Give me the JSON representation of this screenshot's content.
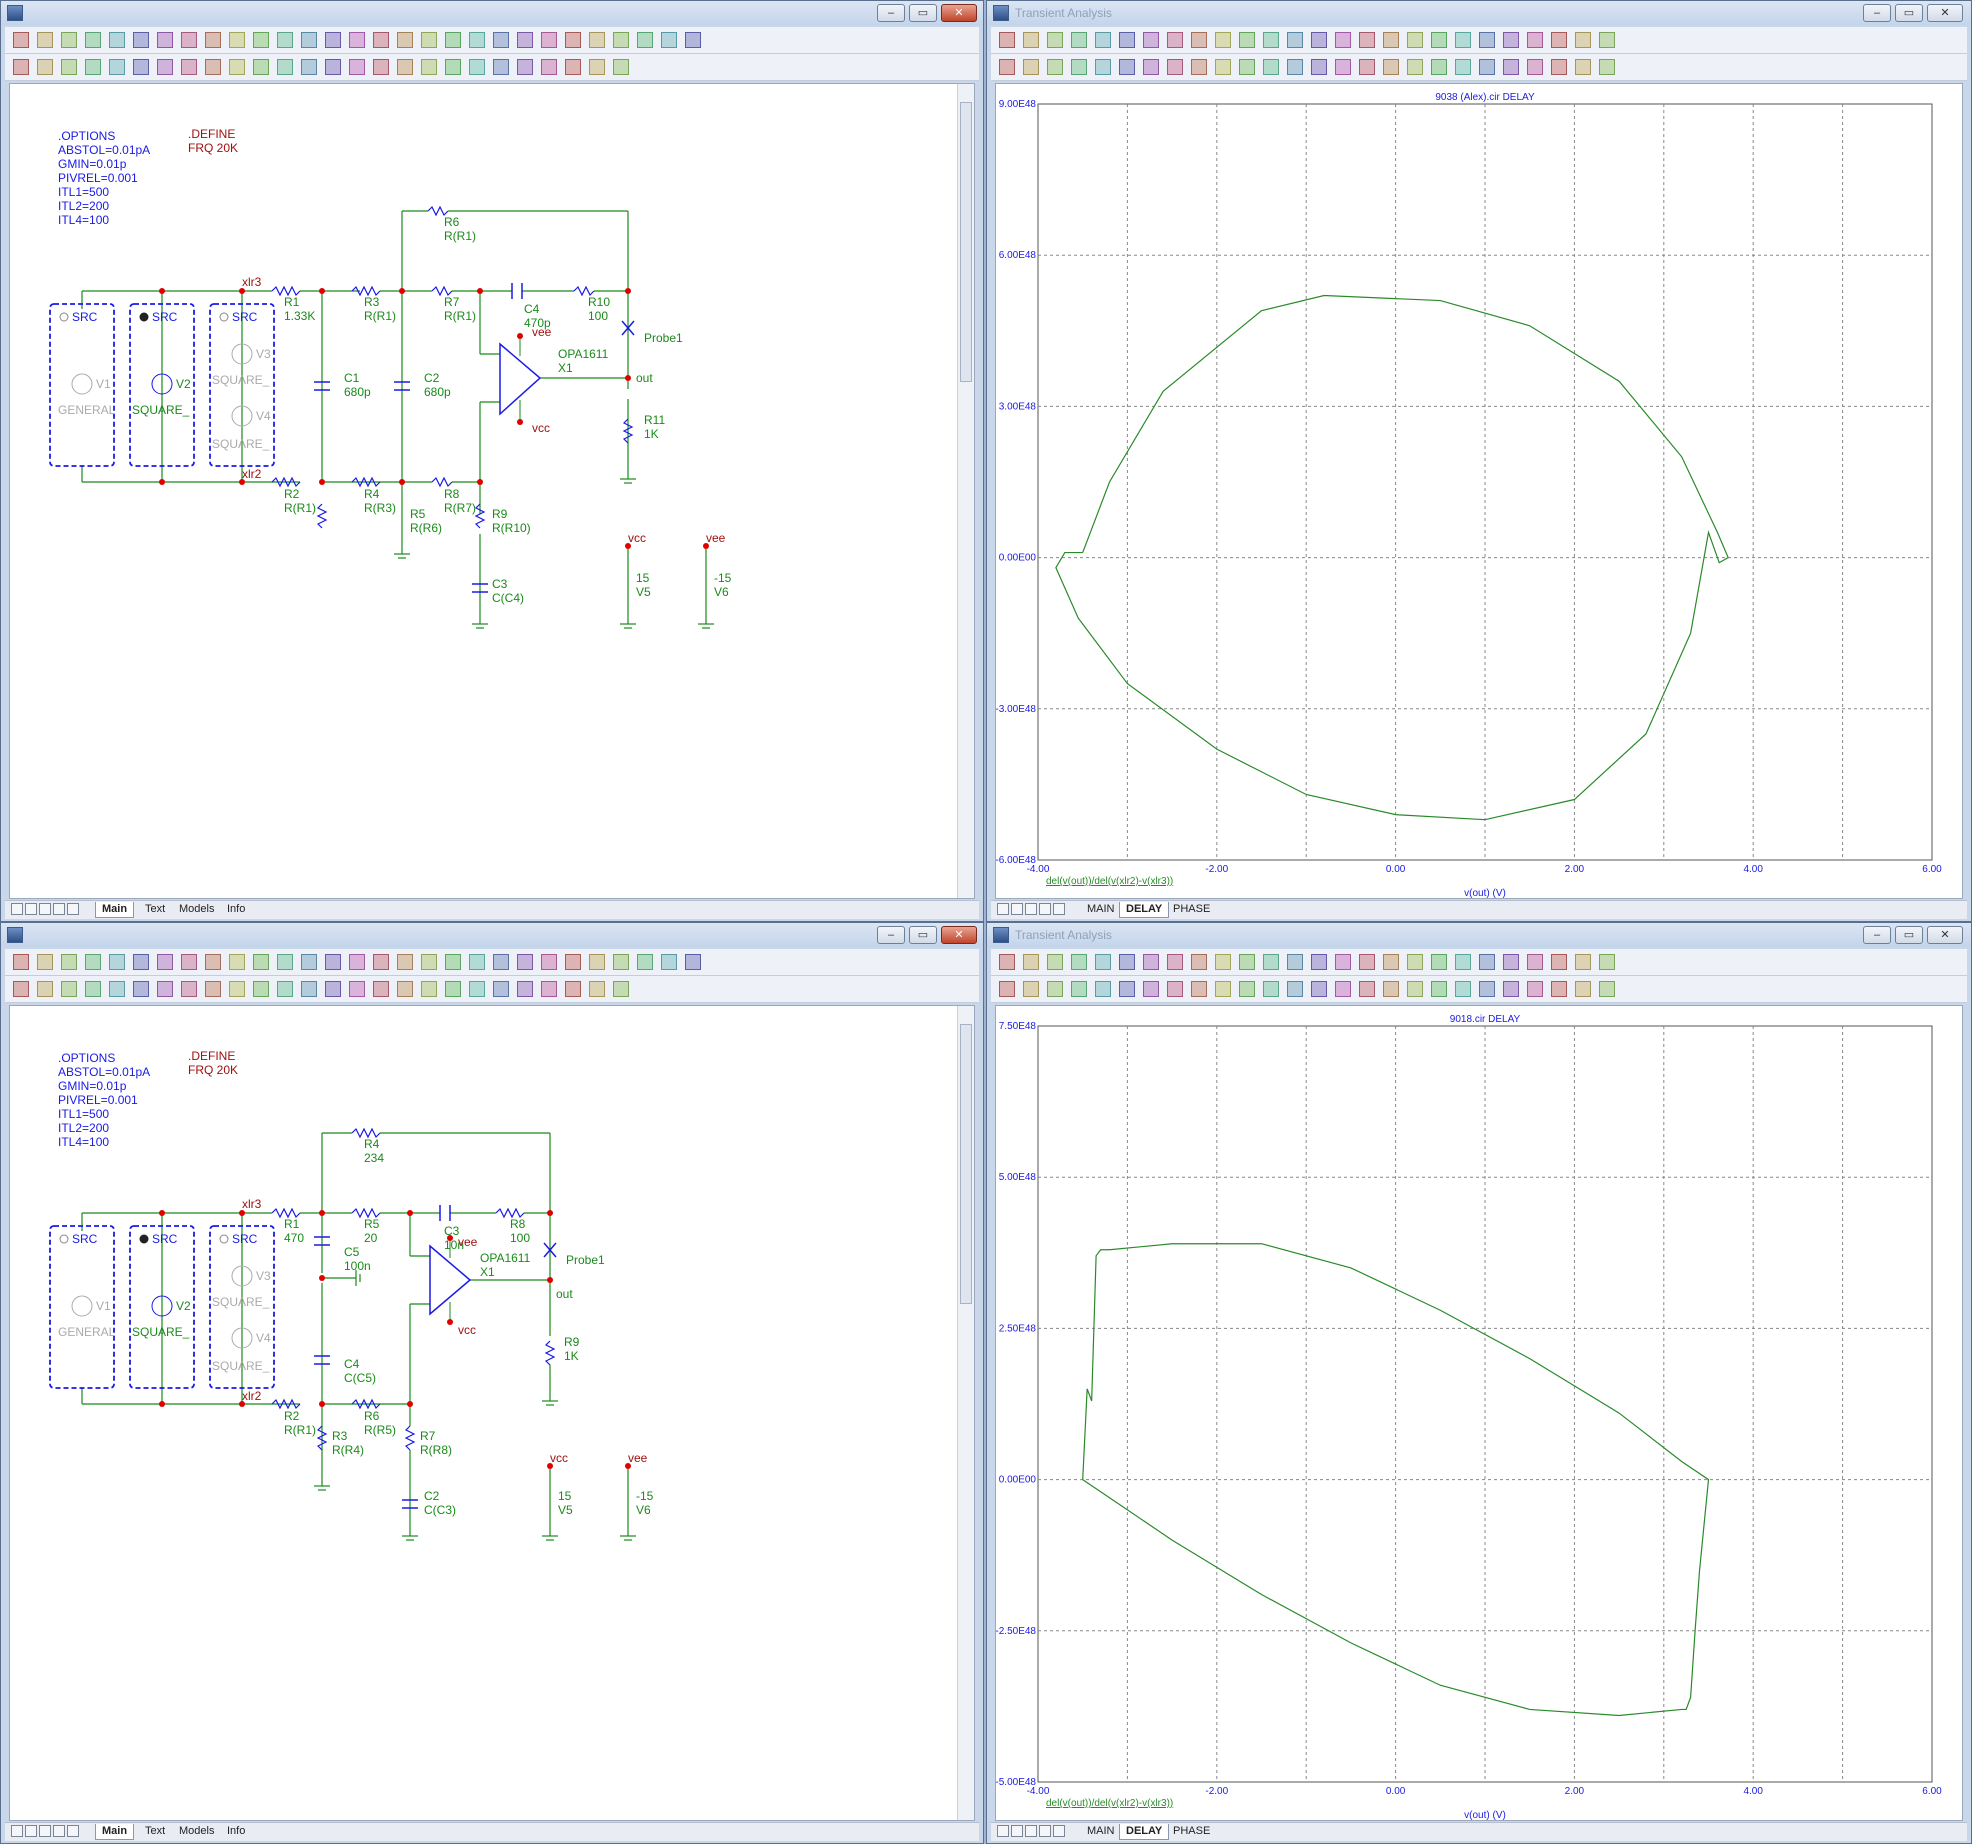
{
  "schematic_windows": [
    {
      "title": "",
      "directives": [
        ".OPTIONS",
        "ABSTOL=0.01pA",
        "GMIN=0.01p",
        "PIVREL=0.001",
        "ITL1=500",
        "ITL2=200",
        "ITL4=100"
      ],
      "define": [
        ".DEFINE",
        "FRQ 20K"
      ],
      "sources": [
        {
          "tag": "SRC",
          "device": "V1",
          "model": "GENERAL",
          "selected": false
        },
        {
          "tag": "SRC",
          "device": "V2",
          "model": "SQUARE_",
          "selected": true
        },
        {
          "tag": "SRC",
          "device": "V3",
          "model": "SQUARE_",
          "selected": false,
          "device2": "V4",
          "model2": "SQUARE_"
        }
      ],
      "labels": {
        "xlr3": "xlr3",
        "xlr2": "xlr2",
        "r1": "R1",
        "r1v": "1.33K",
        "r3": "R3",
        "r3v": "R(R1)",
        "r6": "R6",
        "r6v": "R(R1)",
        "r7": "R7",
        "r7v": "R(R1)",
        "c4": "C4",
        "c4v": "470p",
        "r10": "R10",
        "r10v": "100",
        "probe": "Probe1",
        "out": "out",
        "c1": "C1",
        "c1v": "680p",
        "c2": "C2",
        "c2v": "680p",
        "opamp": "OPA1611",
        "x1": "X1",
        "vee": "vee",
        "vcc": "vcc",
        "r11": "R11",
        "r11v": "1K",
        "r2": "R2",
        "r2v": "R(R1)",
        "r4": "R4",
        "r4v": "R(R3)",
        "r8": "R8",
        "r8v": "R(R7)",
        "r5": "R5",
        "r5v": "R(R6)",
        "r9": "R9",
        "r9v": "R(R10)",
        "c3": "C3",
        "c3v": "C(C4)",
        "vcc2": "vcc",
        "v5val": "15",
        "v5": "V5",
        "vee2": "vee",
        "v6val": "-15",
        "v6": "V6"
      },
      "tabs": [
        "Main",
        "Text",
        "Models",
        "Info"
      ]
    },
    {
      "title": "",
      "directives": [
        ".OPTIONS",
        "ABSTOL=0.01pA",
        "GMIN=0.01p",
        "PIVREL=0.001",
        "ITL1=500",
        "ITL2=200",
        "ITL4=100"
      ],
      "define": [
        ".DEFINE",
        "FRQ 20K"
      ],
      "sources": [
        {
          "tag": "SRC",
          "device": "V1",
          "model": "GENERAL",
          "selected": false
        },
        {
          "tag": "SRC",
          "device": "V2",
          "model": "SQUARE_",
          "selected": true
        },
        {
          "tag": "SRC",
          "device": "V3",
          "model": "SQUARE_",
          "selected": false,
          "device2": "V4",
          "model2": "SQUARE_"
        }
      ],
      "labels": {
        "xlr3": "xlr3",
        "xlr2": "xlr2",
        "r4": "R4",
        "r4v": "234",
        "r1": "R1",
        "r1v": "470",
        "r5": "R5",
        "r5v": "20",
        "c3": "C3",
        "c3v": "10n",
        "r8": "R8",
        "r8v": "100",
        "c5": "C5",
        "c5v": "100n",
        "probe": "Probe1",
        "out": "out",
        "opamp": "OPA1611",
        "x1": "X1",
        "vee": "vee",
        "vcc": "vcc",
        "r9": "R9",
        "r9v": "1K",
        "c4": "C4",
        "c4v": "C(C5)",
        "r2": "R2",
        "r2v": "R(R1)",
        "r6": "R6",
        "r6v": "R(R5)",
        "r3": "R3",
        "r3v": "R(R4)",
        "r7": "R7",
        "r7v": "R(R8)",
        "c2": "C2",
        "c2v": "C(C3)",
        "vcc2": "vcc",
        "v5val": "15",
        "v5": "V5",
        "vee2": "vee",
        "v6val": "-15",
        "v6": "V6"
      },
      "tabs": [
        "Main",
        "Text",
        "Models",
        "Info"
      ]
    }
  ],
  "analysis_windows": [
    {
      "title": "Transient Analysis",
      "tabs": [
        "MAIN",
        "DELAY",
        "PHASE"
      ],
      "active_tab": "DELAY"
    },
    {
      "title": "Transient Analysis",
      "tabs": [
        "MAIN",
        "DELAY",
        "PHASE"
      ],
      "active_tab": "DELAY"
    }
  ],
  "colors": {
    "trace": "#2a8a2a",
    "axis_text": "#1a1ae6",
    "schematic_green": "#1a8a1a",
    "schematic_blue": "#1a1ae6",
    "node_red": "#e00000",
    "directive_red": "#a01010"
  },
  "chart_data": [
    {
      "type": "scatter",
      "title": "9038 (Alex).cir DELAY",
      "xlabel": "v(out) (V)",
      "ylabel": "",
      "trace_label": "del(v(out))/del(v(xlr2)-v(xlr3))",
      "xlim": [
        -4,
        6
      ],
      "ylim": [
        -6e+48,
        9e+48
      ],
      "x_ticks": [
        "-4.00",
        "-2.00",
        "0.00",
        "2.00",
        "4.00",
        "6.00"
      ],
      "y_ticks": [
        "-6.00E48",
        "-3.00E48",
        "0.00E00",
        "3.00E48",
        "6.00E48",
        "9.00E48"
      ],
      "y_tick_values": [
        -6e+48,
        -3e+48,
        0,
        3e+48,
        6e+48,
        9e+48
      ],
      "grid": true,
      "series": [
        {
          "x": [
            -3.5,
            -3.2,
            -2.6,
            -1.5,
            -0.8,
            0.5,
            1.5,
            2.5,
            3.2,
            3.6,
            3.72,
            3.62,
            3.5,
            3.3,
            2.8,
            2.0,
            1.0,
            0.0,
            -1.0,
            -2.0,
            -3.0,
            -3.55,
            -3.8,
            -3.7,
            -3.5
          ],
          "y": [
            1e+47,
            1.5e+48,
            3.3e+48,
            4.9e+48,
            5.2e+48,
            5.1e+48,
            4.6e+48,
            3.5e+48,
            2e+48,
            5e+47,
            0.0,
            -1e+47,
            5e+47,
            -1.5e+48,
            -3.5e+48,
            -4.8e+48,
            -5.2e+48,
            -5.1e+48,
            -4.7e+48,
            -3.8e+48,
            -2.5e+48,
            -1.2e+48,
            -2e+47,
            1e+47,
            1e+47
          ]
        }
      ]
    },
    {
      "type": "scatter",
      "title": "9018.cir DELAY",
      "xlabel": "v(out) (V)",
      "ylabel": "",
      "trace_label": "del(v(out))/del(v(xlr2)-v(xlr3))",
      "xlim": [
        -4,
        6
      ],
      "ylim": [
        -5e+48,
        7.5e+48
      ],
      "x_ticks": [
        "-4.00",
        "-2.00",
        "0.00",
        "2.00",
        "4.00",
        "6.00"
      ],
      "y_ticks": [
        "-5.00E48",
        "-2.50E48",
        "0.00E00",
        "2.50E48",
        "5.00E48",
        "7.50E48"
      ],
      "y_tick_values": [
        -5e+48,
        -2.5e+48,
        0,
        2.5e+48,
        5e+48,
        7.5e+48
      ],
      "grid": true,
      "series": [
        {
          "x": [
            -3.5,
            -3.45,
            -3.4,
            -3.35,
            -3.3,
            -3.2,
            -2.5,
            -1.5,
            -0.5,
            0.5,
            1.5,
            2.5,
            3.2,
            3.5,
            3.4,
            3.35,
            3.3,
            3.25,
            3.2,
            2.5,
            1.5,
            0.5,
            -0.5,
            -1.5,
            -2.5,
            -3.2,
            -3.5
          ],
          "y": [
            0,
            1.5e+48,
            1.3e+48,
            3.7e+48,
            3.8e+48,
            3.8e+48,
            3.9e+48,
            3.9e+48,
            3.5e+48,
            2.8e+48,
            2e+48,
            1.1e+48,
            3e+47,
            0,
            -1.5e+48,
            -2.5e+48,
            -3.6e+48,
            -3.8e+48,
            -3.8e+48,
            -3.9e+48,
            -3.8e+48,
            -3.4e+48,
            -2.7e+48,
            -1.9e+48,
            -1e+48,
            -3e+47,
            0
          ]
        }
      ]
    }
  ]
}
